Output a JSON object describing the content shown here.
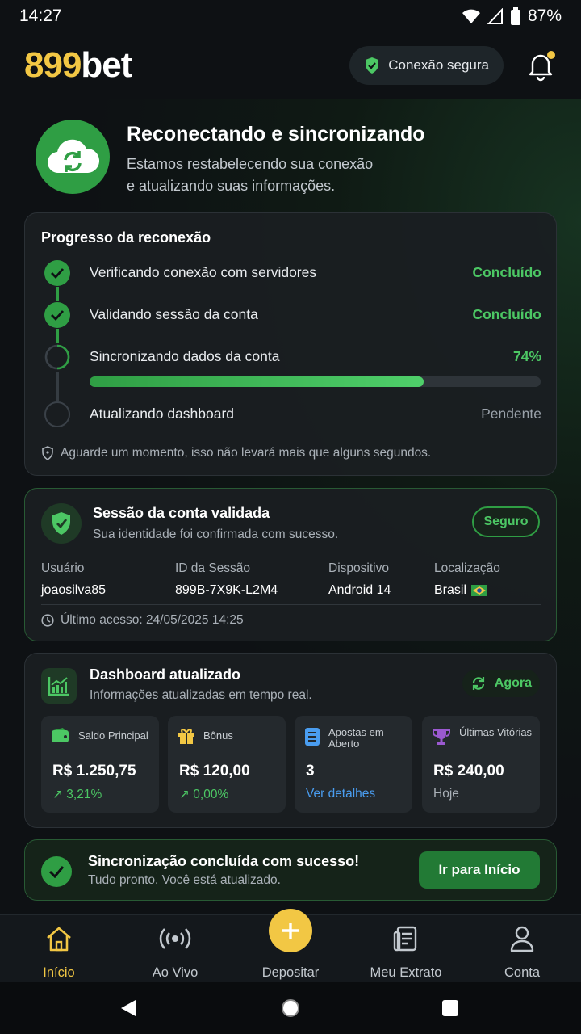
{
  "status_bar": {
    "time": "14:27",
    "battery": "87%"
  },
  "header": {
    "logo_num": "899",
    "logo_text": "bet",
    "secure_label": "Conexão segura",
    "notification_dot": true
  },
  "hero": {
    "title": "Reconectando e sincronizando",
    "subtitle_line1": "Estamos restabelecendo sua conexão",
    "subtitle_line2": "e atualizando suas informações."
  },
  "progress": {
    "title": "Progresso da reconexão",
    "steps": [
      {
        "label": "Verificando conexão com servidores",
        "state": "Concluído"
      },
      {
        "label": "Validando sessão da conta",
        "state": "Concluído"
      },
      {
        "label": "Sincronizando dados da conta",
        "state": "74%",
        "progress_fraction": 0.74
      },
      {
        "label": "Atualizando dashboard",
        "state": "Pendente"
      }
    ],
    "footer": "Aguarde um momento, isso não levará mais que alguns segundos."
  },
  "session": {
    "title": "Sessão da conta validada",
    "subtitle": "Sua identidade foi confirmada com sucesso.",
    "badge": "Seguro",
    "fields": [
      {
        "key": "Usuário",
        "value": "joaosilva85"
      },
      {
        "key": "ID da Sessão",
        "value": "899B-7X9K-L2M4"
      },
      {
        "key": "Dispositivo",
        "value": "Android 14"
      },
      {
        "key": "Localização",
        "value": "Brasil"
      }
    ],
    "last_access": "Último acesso: 24/05/2025 14:25"
  },
  "dashboard": {
    "title": "Dashboard atualizado",
    "subtitle": "Informações atualizadas em tempo real.",
    "refresh_label": "Agora",
    "tiles": [
      {
        "label": "Saldo Principal",
        "value": "R$ 1.250,75",
        "footer": "3,21%",
        "icon": "wallet-icon"
      },
      {
        "label": "Bônus",
        "value": "R$ 120,00",
        "footer": "0,00%",
        "icon": "gift-icon"
      },
      {
        "label_line1": "Apostas em",
        "label_line2": "Aberto",
        "value": "3",
        "footer": "Ver detalhes",
        "icon": "list-icon"
      },
      {
        "label": "Últimas Vitórias",
        "value": "R$ 240,00",
        "footer": "Hoje",
        "icon": "trophy-icon"
      }
    ]
  },
  "sync": {
    "title": "Sincronização concluída com sucesso!",
    "subtitle": "Tudo pronto. Você está atualizado.",
    "button": "Ir para Início"
  },
  "nav": {
    "items": [
      {
        "label": "Início",
        "icon": "home-icon"
      },
      {
        "label": "Ao Vivo",
        "icon": "live-icon"
      },
      {
        "label": "Depositar",
        "icon": "plus-icon"
      },
      {
        "label": "Meu Extrato",
        "icon": "statement-icon"
      },
      {
        "label": "Conta",
        "icon": "user-icon"
      }
    ]
  },
  "colors": {
    "accent_green": "#4cc764",
    "brand_yellow": "#f2c744",
    "background": "#0e1114",
    "link_blue": "#4a9df0"
  }
}
